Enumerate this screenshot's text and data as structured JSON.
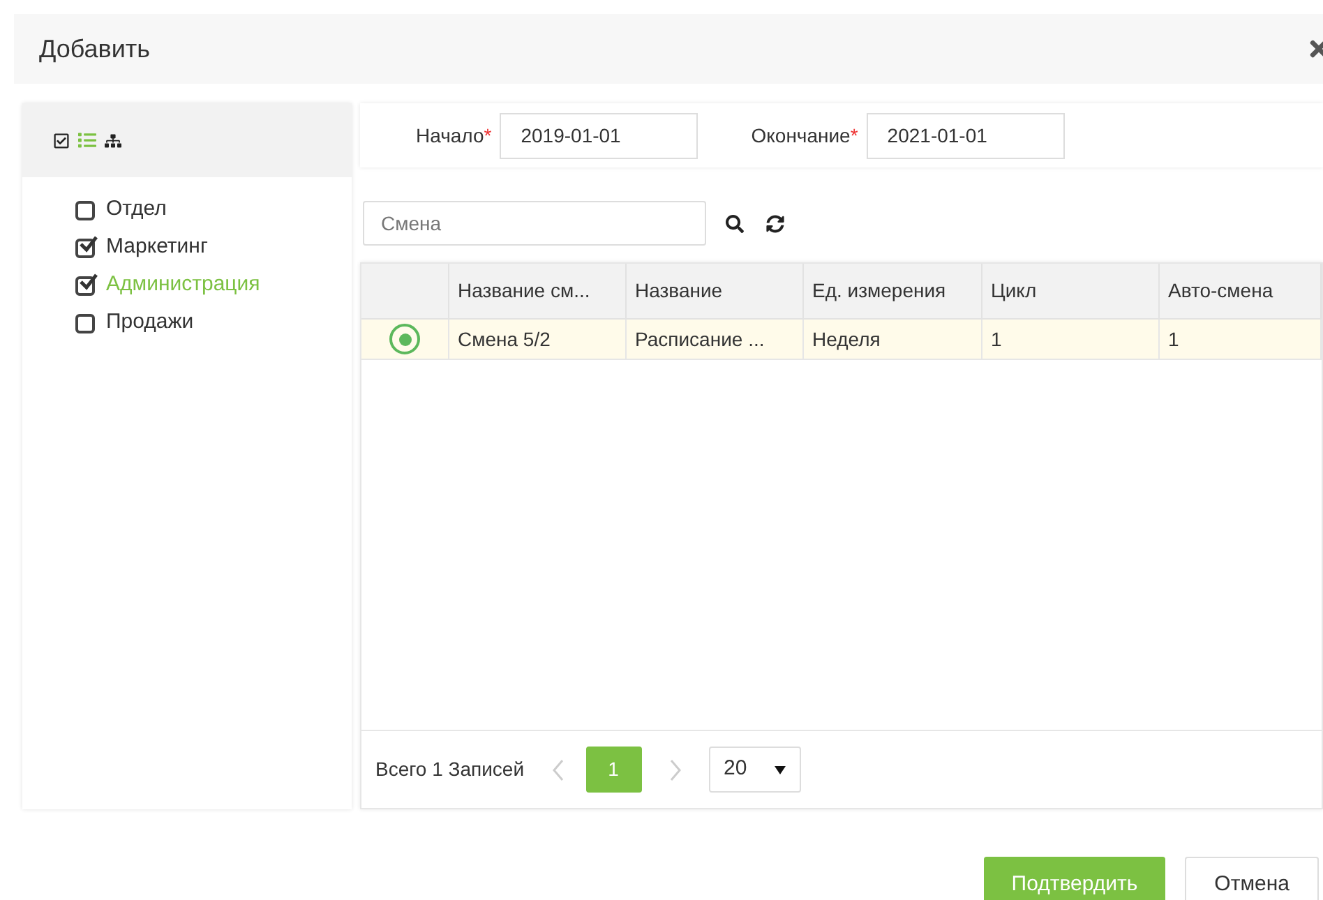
{
  "dialog": {
    "title": "Добавить"
  },
  "view_modes": [
    {
      "kind": "checkbox",
      "selected": false
    },
    {
      "kind": "list",
      "selected": true
    },
    {
      "kind": "tree",
      "selected": false
    }
  ],
  "departments": [
    {
      "label": "Отдел",
      "checked": false,
      "selected": false
    },
    {
      "label": "Маркетинг",
      "checked": true,
      "selected": false
    },
    {
      "label": "Администрация",
      "checked": true,
      "selected": true
    },
    {
      "label": "Продажи",
      "checked": false,
      "selected": false
    }
  ],
  "date_range": {
    "start_label": "Начало",
    "start_mark": "*",
    "end_mark": "*",
    "start_value": "2019-01-01",
    "end_label": "Окончание",
    "end_value": "2021-01-01"
  },
  "search": {
    "placeholder": "Смена"
  },
  "table": {
    "columns": [
      "Название см...",
      "Название",
      "Ед. измерения",
      "Цикл",
      "Авто-смена"
    ],
    "rows": [
      {
        "selected": true,
        "cells": [
          "Смена 5/2",
          "Расписание ...",
          "Неделя",
          "1",
          "1"
        ]
      }
    ]
  },
  "pagination": {
    "total": "Всего 1 Записей",
    "pages": [
      {
        "label": "1",
        "selected": true
      }
    ],
    "page_size": "20"
  },
  "buttons": [
    {
      "label": "Подтвердить",
      "kind": "primary"
    },
    {
      "label": "Отмена",
      "kind": "secondary"
    }
  ]
}
